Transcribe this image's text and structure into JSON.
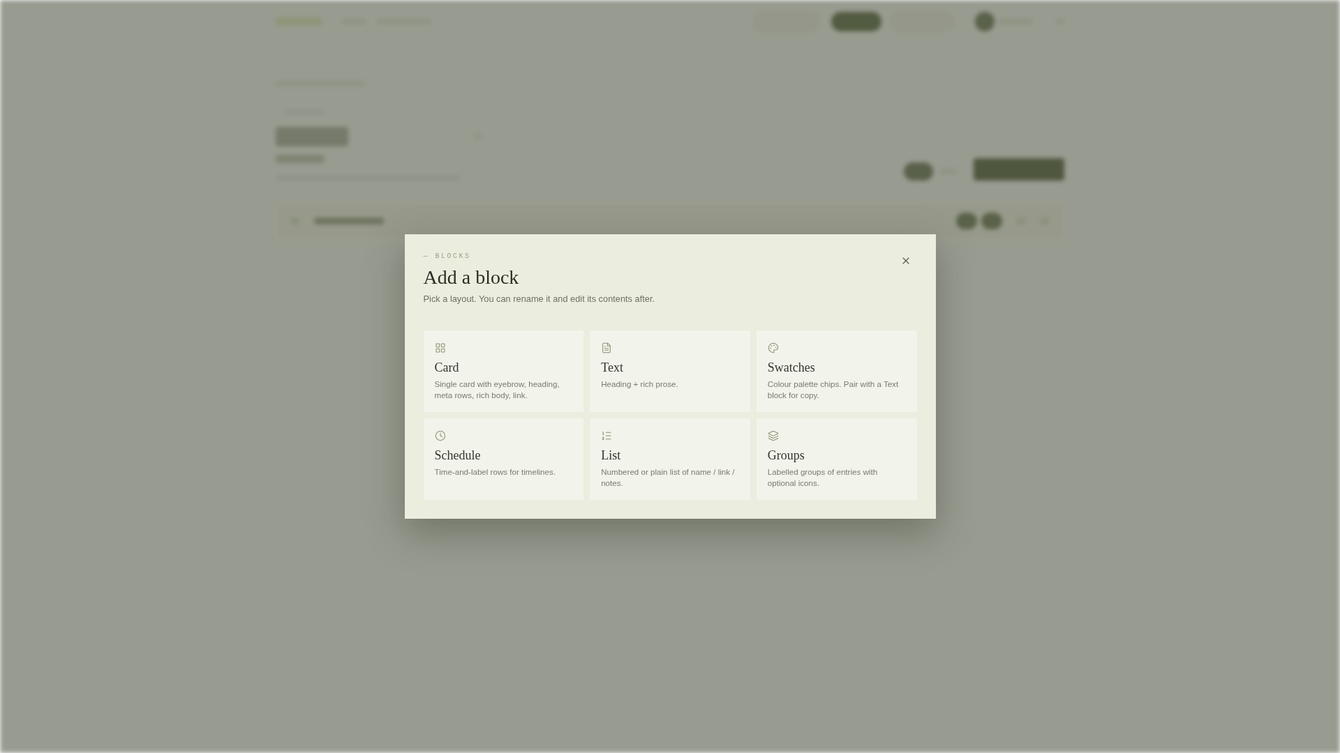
{
  "dialog": {
    "eyebrow": "— BLOCKS",
    "title": "Add a block",
    "subtitle": "Pick a layout. You can rename it and edit its contents after.",
    "blocks": [
      {
        "kind": "card",
        "name": "Card",
        "description": "Single card with eyebrow, heading, meta rows, rich body, link."
      },
      {
        "kind": "text",
        "name": "Text",
        "description": "Heading + rich prose."
      },
      {
        "kind": "swatches",
        "name": "Swatches",
        "description": "Colour palette chips. Pair with a Text block for copy."
      },
      {
        "kind": "schedule",
        "name": "Schedule",
        "description": "Time-and-label rows for timelines."
      },
      {
        "kind": "list",
        "name": "List",
        "description": "Numbered or plain list of name / link / notes."
      },
      {
        "kind": "groups",
        "name": "Groups",
        "description": "Labelled groups of entries with optional icons."
      }
    ]
  }
}
